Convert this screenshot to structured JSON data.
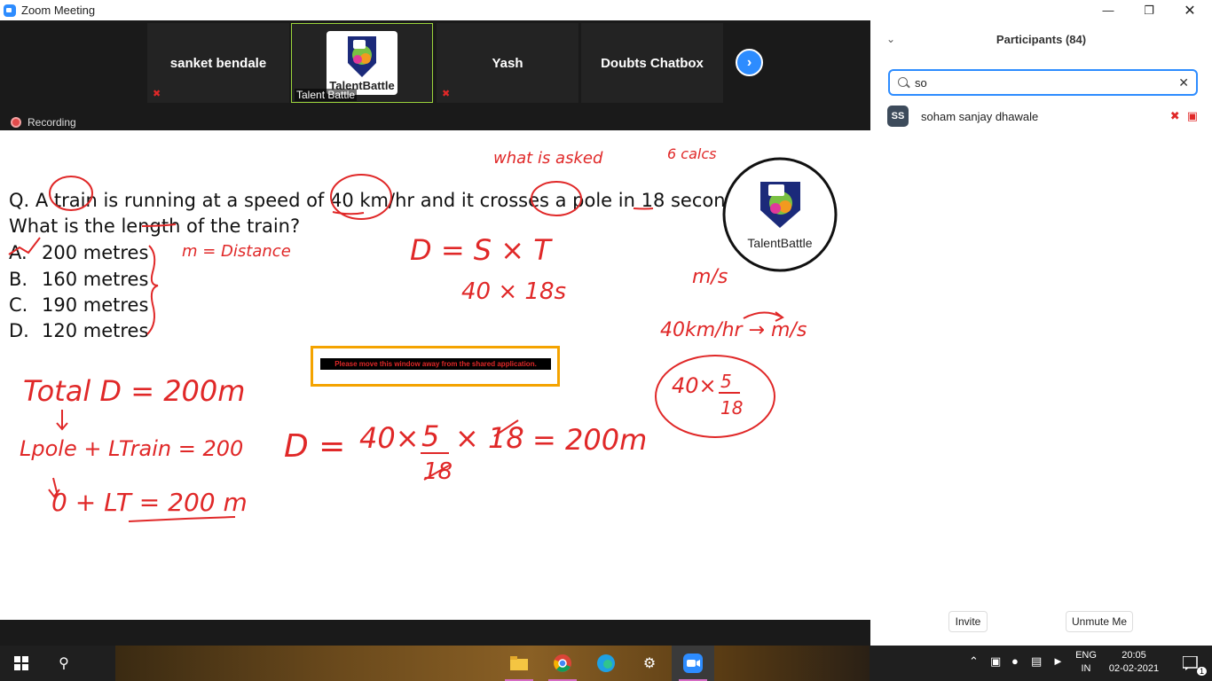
{
  "window": {
    "title": "Zoom Meeting"
  },
  "strip": {
    "tiles": [
      {
        "name": "sanket bendale"
      },
      {
        "name": "Talent Battle",
        "logo": "TalentBattle"
      },
      {
        "name": "Yash"
      },
      {
        "name": "Doubts Chatbox"
      }
    ],
    "recording": "Recording"
  },
  "board": {
    "question_line1": "Q. A train is running at a speed of 40 km/hr and it crosses a pole in 18 seconds.",
    "question_line2": "What is the length of the train?",
    "options": [
      {
        "key": "A.",
        "text": "200 metres"
      },
      {
        "key": "B.",
        "text": "160 metres"
      },
      {
        "key": "C.",
        "text": "190 metres"
      },
      {
        "key": "D.",
        "text": "120 metres"
      }
    ],
    "logo": "TalentBattle",
    "warning": "Please move this window away from the shared application.",
    "ink": {
      "what_is_asked": "what is asked",
      "calc": "6 calcs",
      "distance_note": "m = Distance",
      "formula": "D = S × T",
      "formula_values": "40 × 18s",
      "unit_ms": "m/s",
      "conversion": "40km/hr → m/s",
      "conv_num": "40×",
      "conv_frac_num": "5",
      "conv_frac_den": "18",
      "total": "Total D = 200m",
      "lpole": "Lpole + LTrain = 200",
      "zero_lt": "0 + LT = 200 m",
      "big_d": "D =",
      "big_calc": "40×",
      "big_five": "5",
      "big_eighteen_den": "18",
      "big_times": "× 18",
      "big_result": "= 200m"
    }
  },
  "participants": {
    "title": "Participants (84)",
    "search_value": "so",
    "list": [
      {
        "initials": "SS",
        "name": "soham sanjay dhawale"
      }
    ],
    "invite": "Invite",
    "unmute": "Unmute Me"
  },
  "taskbar": {
    "lang_top": "ENG",
    "lang_bottom": "IN",
    "time": "20:05",
    "date": "02-02-2021",
    "notifications": "1"
  },
  "colors": {
    "accent": "#2d8cff",
    "ink": "#e02828",
    "active_border": "#9bd43b"
  }
}
